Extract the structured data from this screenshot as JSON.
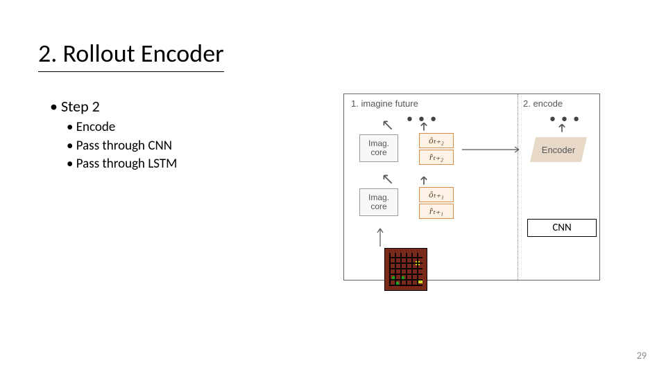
{
  "title": "2. Rollout Encoder",
  "step": "Step 2",
  "bullets": [
    "Encode",
    "Pass through CNN",
    "Pass through LSTM"
  ],
  "fig": {
    "label1": "1. imagine future",
    "label2": "2. encode",
    "dots": "• • •",
    "imag_core": "Imag.\ncore",
    "encoder": "Encoder",
    "o_t2": "ôₜ₊₂",
    "r_t2": "r̂ₜ₊₂",
    "o_t1": "ôₜ₊₁",
    "r_t1": "r̂ₜ₊₁"
  },
  "cnn": "CNN",
  "page": "29"
}
